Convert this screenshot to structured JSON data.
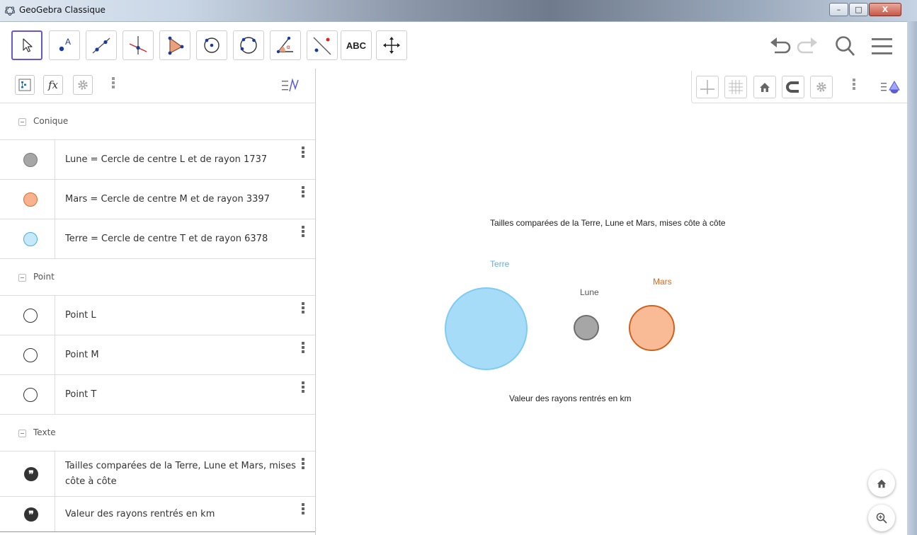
{
  "window": {
    "title": "GeoGebra Classique",
    "controls": {
      "minimize": "–",
      "maximize": "□",
      "close": "X"
    }
  },
  "toolbar": {
    "tools": [
      {
        "name": "move-tool",
        "icon": "arrow-cursor-icon",
        "selected": true
      },
      {
        "name": "point-tool",
        "icon": "point-icon",
        "label": "A"
      },
      {
        "name": "line-tool",
        "icon": "line-icon"
      },
      {
        "name": "perpendicular-tool",
        "icon": "perpendicular-line-icon"
      },
      {
        "name": "polygon-tool",
        "icon": "polygon-icon"
      },
      {
        "name": "circle-tool",
        "icon": "circle-center-point-icon"
      },
      {
        "name": "conic-tool",
        "icon": "circle-three-points-icon"
      },
      {
        "name": "angle-tool",
        "icon": "angle-icon",
        "label": "α"
      },
      {
        "name": "reflect-tool",
        "icon": "reflect-line-icon"
      },
      {
        "name": "text-tool",
        "icon": "text-icon",
        "label": "ABC"
      },
      {
        "name": "move-view-tool",
        "icon": "move-graphics-icon"
      }
    ],
    "right": [
      "undo-icon",
      "redo-icon",
      "search-icon",
      "menu-icon"
    ]
  },
  "algebra": {
    "header_icons": [
      "algebra-sort-icon",
      "fx-icon",
      "gear-icon",
      "more-icon",
      "toggle-input-icon"
    ],
    "groups": [
      {
        "label": "Conique",
        "items": [
          {
            "text": "Lune = Cercle de centre L et de rayon 1737",
            "color": "#a6a6a6",
            "border": "#7a7a7a"
          },
          {
            "text": "Mars = Cercle de centre M et de rayon 3397",
            "color": "#f8b38e",
            "border": "#d96c2e"
          },
          {
            "text": "Terre = Cercle de centre T et de rayon 6378",
            "color": "#c5e9fb",
            "border": "#4aaee0"
          }
        ]
      },
      {
        "label": "Point",
        "items": [
          {
            "text": "Point L"
          },
          {
            "text": "Point M"
          },
          {
            "text": "Point T"
          }
        ]
      },
      {
        "label": "Texte",
        "items": [
          {
            "text_line1": "Tailles comparées de la Terre, Lune et Mars, mises",
            "text_line2": "côte à côte"
          },
          {
            "text": "Valeur des rayons rentrés en km"
          }
        ]
      }
    ]
  },
  "graphics": {
    "toolbar_icons": [
      "axes-icon",
      "grid-icon",
      "home-icon",
      "magnet-icon",
      "gear-icon",
      "more-icon",
      "style-bar-icon"
    ],
    "title": "Tailles comparées de la Terre, Lune et Mars, mises côte à côte",
    "caption": "Valeur des rayons rentrés en km",
    "labels": {
      "terre": "Terre",
      "lune": "Lune",
      "mars": "Mars"
    },
    "colors": {
      "terre_fill": "#a6dcf8",
      "terre_stroke": "#7fcbf3",
      "terre_label": "#4fb8ea",
      "lune_fill": "#a6a6a6",
      "lune_stroke": "#6e6e6e",
      "lune_label": "#555555",
      "mars_fill": "#f9bb96",
      "mars_stroke": "#cf6120",
      "mars_label": "#e0661e"
    },
    "corner_buttons": [
      "home-icon",
      "zoom-icon"
    ]
  }
}
